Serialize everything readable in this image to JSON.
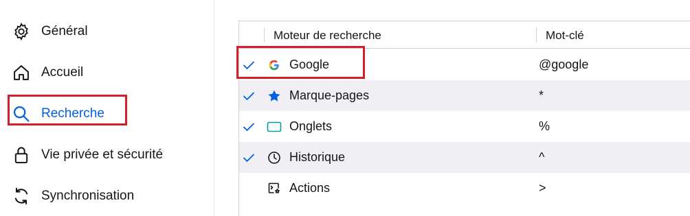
{
  "sidebar": {
    "items": [
      {
        "label": "Général",
        "icon": "gear-icon"
      },
      {
        "label": "Accueil",
        "icon": "home-icon"
      },
      {
        "label": "Recherche",
        "icon": "search-icon",
        "selected": true
      },
      {
        "label": "Vie privée et sécurité",
        "icon": "lock-icon"
      },
      {
        "label": "Synchronisation",
        "icon": "sync-icon"
      }
    ]
  },
  "table": {
    "headers": {
      "engine": "Moteur de recherche",
      "keyword": "Mot-clé"
    },
    "rows": [
      {
        "checked": true,
        "icon": "google-icon",
        "name": "Google",
        "keyword": "@google"
      },
      {
        "checked": true,
        "icon": "bookmark-star-icon",
        "name": "Marque-pages",
        "keyword": "*"
      },
      {
        "checked": true,
        "icon": "tab-icon",
        "name": "Onglets",
        "keyword": "%"
      },
      {
        "checked": true,
        "icon": "history-clock-icon",
        "name": "Historique",
        "keyword": "^"
      },
      {
        "checked": false,
        "icon": "actions-icon",
        "name": "Actions",
        "keyword": ">"
      }
    ]
  },
  "colors": {
    "accent": "#0061e0",
    "highlight": "#d41f2b",
    "row_alt": "#f0f0f4",
    "tab_icon": "#00a0a0"
  }
}
